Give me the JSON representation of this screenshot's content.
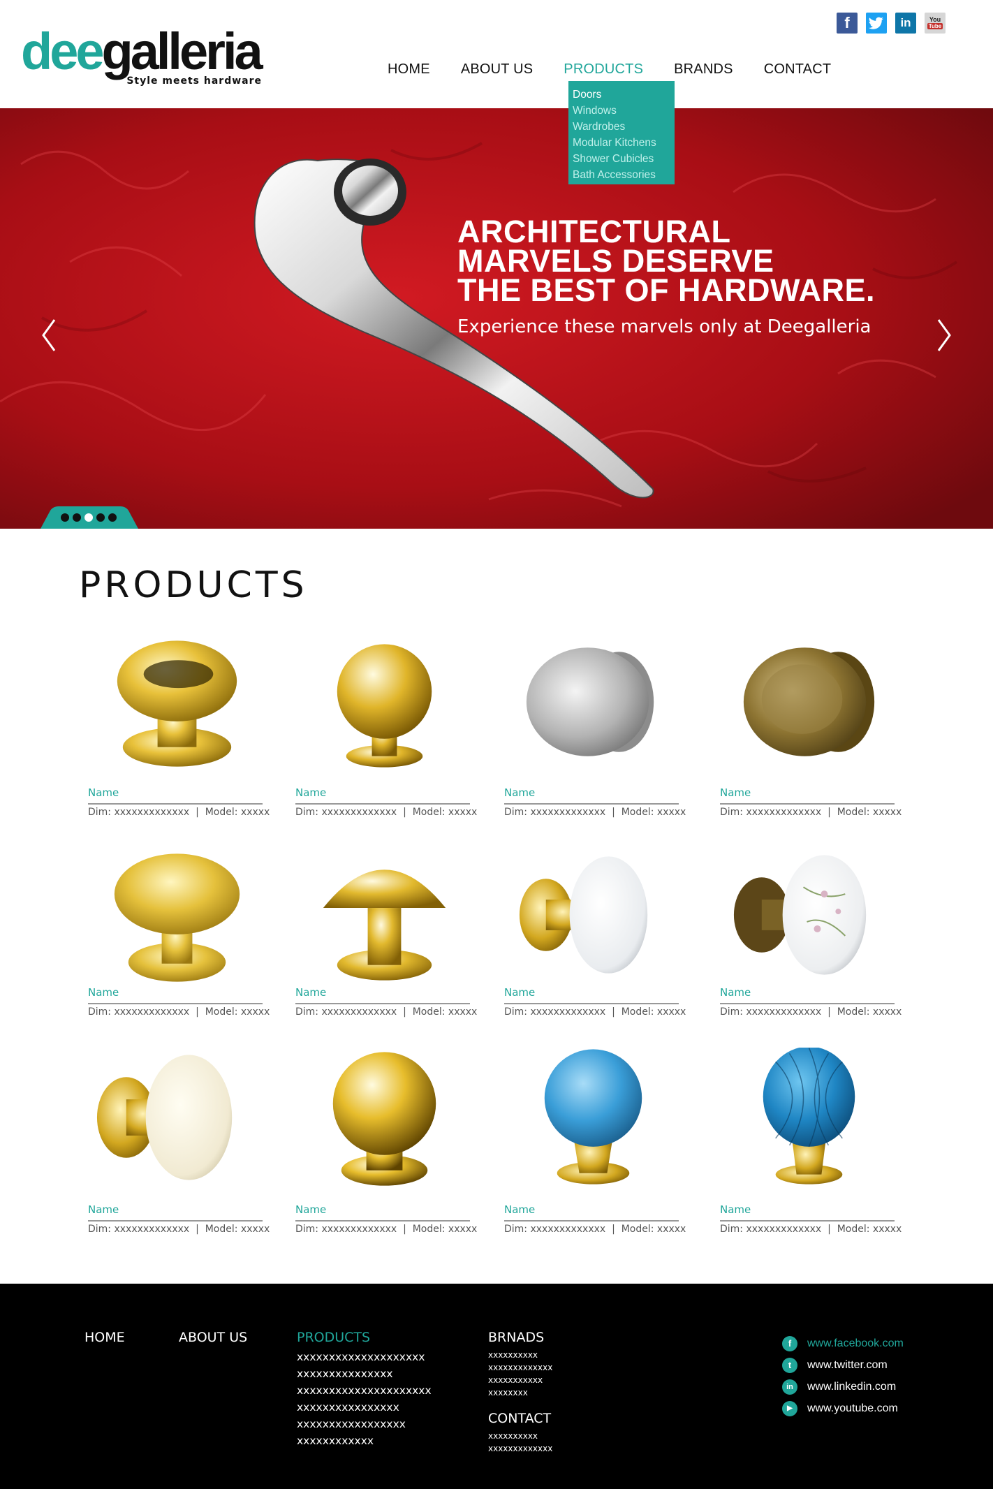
{
  "brand": {
    "name_part1": "dee",
    "name_part2": "galleria",
    "tagline": "Style meets hardware"
  },
  "social_top": [
    {
      "icon": "facebook-icon",
      "glyph": "f",
      "color": "#3b5998"
    },
    {
      "icon": "twitter-icon",
      "glyph": "t",
      "color": "#1da1f2"
    },
    {
      "icon": "linkedin-icon",
      "glyph": "in",
      "color": "#0e76a8"
    },
    {
      "icon": "youtube-icon",
      "glyph": "You Tube",
      "color": "#c4302b"
    }
  ],
  "nav": {
    "items": [
      "HOME",
      "ABOUT US",
      "PRODUCTS",
      "BRANDS",
      "CONTACT"
    ],
    "active": "PRODUCTS"
  },
  "dropdown": {
    "items": [
      "Doors",
      "Windows",
      "Wardrobes",
      "Modular Kitchens",
      "Shower Cubicles",
      "Bath Accessories"
    ]
  },
  "hero": {
    "headline": [
      "ARCHITECTURAL",
      "MARVELS DESERVE",
      "THE BEST OF HARDWARE."
    ],
    "subline": "Experience these marvels only at Deegalleria",
    "slide_count": 5,
    "active_slide": 2
  },
  "products": {
    "title": "PRODUCTS",
    "items": [
      {
        "name": "Name",
        "dim": "Dim: xxxxxxxxxxxxx",
        "model": "Model: xxxxx",
        "image": "brass-mushroom-knob"
      },
      {
        "name": "Name",
        "dim": "Dim: xxxxxxxxxxxxx",
        "model": "Model: xxxxx",
        "image": "brass-ball-knob"
      },
      {
        "name": "Name",
        "dim": "Dim: xxxxxxxxxxxxx",
        "model": "Model: xxxxx",
        "image": "satin-chrome-knob"
      },
      {
        "name": "Name",
        "dim": "Dim: xxxxxxxxxxxxx",
        "model": "Model: xxxxx",
        "image": "antique-bronze-knob"
      },
      {
        "name": "Name",
        "dim": "Dim: xxxxxxxxxxxxx",
        "model": "Model: xxxxx",
        "image": "brass-flat-knob"
      },
      {
        "name": "Name",
        "dim": "Dim: xxxxxxxxxxxxx",
        "model": "Model: xxxxx",
        "image": "brass-dome-knob"
      },
      {
        "name": "Name",
        "dim": "Dim: xxxxxxxxxxxxx",
        "model": "Model: xxxxx",
        "image": "white-porcelain-knob"
      },
      {
        "name": "Name",
        "dim": "Dim: xxxxxxxxxxxxx",
        "model": "Model: xxxxx",
        "image": "floral-porcelain-knob"
      },
      {
        "name": "Name",
        "dim": "Dim: xxxxxxxxxxxxx",
        "model": "Model: xxxxx",
        "image": "cream-porcelain-knob"
      },
      {
        "name": "Name",
        "dim": "Dim: xxxxxxxxxxxxx",
        "model": "Model: xxxxx",
        "image": "polished-brass-ball-knob"
      },
      {
        "name": "Name",
        "dim": "Dim: xxxxxxxxxxxxx",
        "model": "Model: xxxxx",
        "image": "blue-glass-ball-knob"
      },
      {
        "name": "Name",
        "dim": "Dim: xxxxxxxxxxxxx",
        "model": "Model: xxxxx",
        "image": "blue-crystal-knob"
      }
    ]
  },
  "footer": {
    "home": "HOME",
    "about": "ABOUT US",
    "products_heading": "PRODUCTS",
    "products_list": [
      "xxxxxxxxxxxxxxxxxxxx",
      "xxxxxxxxxxxxxxx",
      "xxxxxxxxxxxxxxxxxxxxx",
      "xxxxxxxxxxxxxxxx",
      "xxxxxxxxxxxxxxxxx",
      "xxxxxxxxxxxx"
    ],
    "brands_heading": "BRNADS",
    "brands_list": [
      "xxxxxxxxxx",
      "xxxxxxxxxxxxx",
      "xxxxxxxxxxx",
      "xxxxxxxx"
    ],
    "contact_heading": "CONTACT",
    "contact_list": [
      "xxxxxxxxxx",
      "xxxxxxxxxxxxx"
    ],
    "social": [
      {
        "icon": "facebook-icon",
        "glyph": "f",
        "url": "www.facebook.com"
      },
      {
        "icon": "twitter-icon",
        "glyph": "t",
        "url": "www.twitter.com"
      },
      {
        "icon": "linkedin-icon",
        "glyph": "in",
        "url": "www.linkedin.com"
      },
      {
        "icon": "youtube-icon",
        "glyph": "▶",
        "url": "www.youtube.com"
      }
    ]
  },
  "colors": {
    "accent": "#20a69a",
    "hero_red": "#b5121b",
    "footer_bg": "#000000"
  }
}
